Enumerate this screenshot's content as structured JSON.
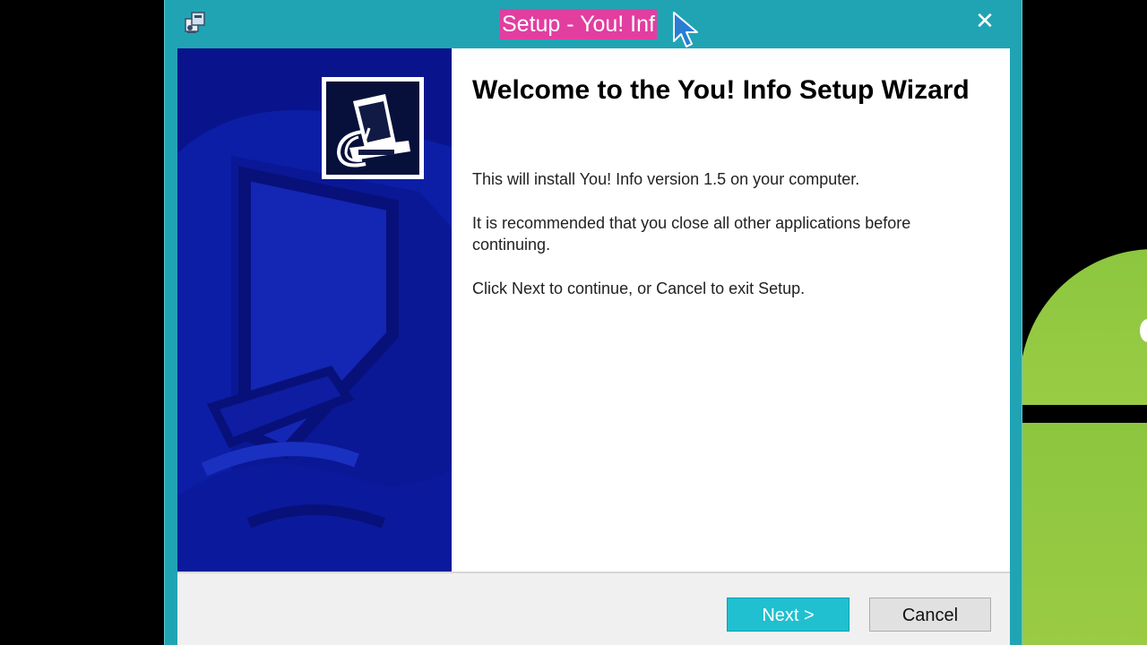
{
  "window": {
    "title": "Setup - You! Inf",
    "close_glyph": "✕"
  },
  "wizard": {
    "heading": "Welcome to the You! Info Setup Wizard",
    "line1": "This will install You! Info version 1.5 on your computer.",
    "line2": "It is recommended that you close all other applications before continuing.",
    "line3": "Click Next to continue, or Cancel to exit Setup."
  },
  "buttons": {
    "next_label": "Next >",
    "cancel_label": "Cancel"
  },
  "icons": {
    "app": "setup-installer-icon",
    "logo": "computer-install-icon",
    "close": "close-icon",
    "cursor": "mouse-cursor-icon"
  },
  "colors": {
    "titlebar": "#20a4b4",
    "title_highlight": "#e23ea0",
    "left_panel": "#09148c",
    "next_button": "#20c0d0",
    "android_green": "#9ccb45"
  }
}
